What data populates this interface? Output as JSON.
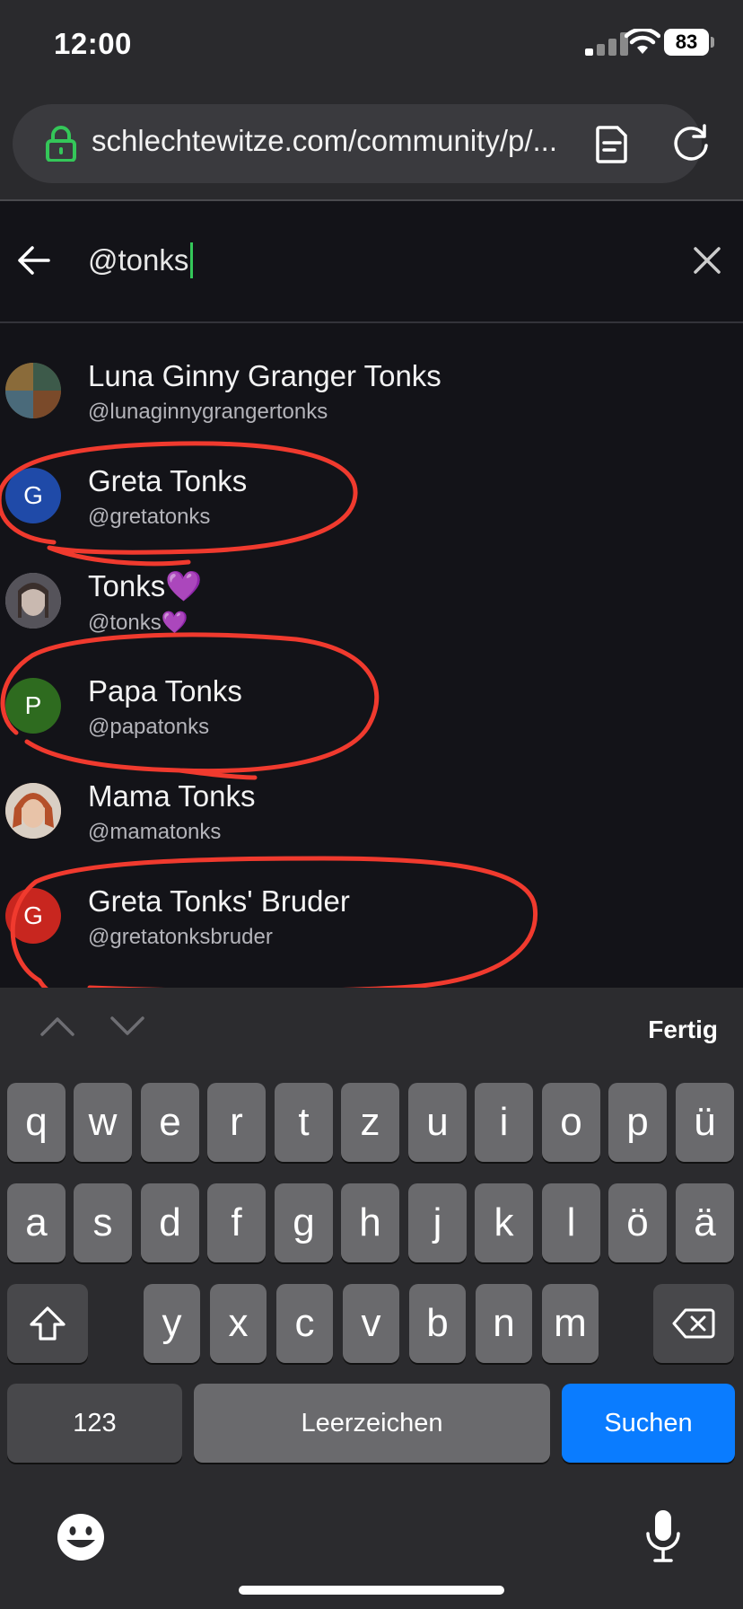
{
  "status_bar": {
    "time": "12:00",
    "battery": "83"
  },
  "browser": {
    "url": "schlechtewitze.com/community/p/..."
  },
  "search": {
    "query": "@tonks"
  },
  "results": [
    {
      "name": "Luna Ginny Granger Tonks",
      "handle": "@lunaginnygrangertonks",
      "avatar_kind": "image",
      "avatar_letter": "",
      "avatar_color": "#6b5a3a"
    },
    {
      "name": "Greta Tonks",
      "handle": "@gretatonks",
      "avatar_kind": "letter",
      "avatar_letter": "G",
      "avatar_color": "#1f4aa8"
    },
    {
      "name": "Tonks💜",
      "handle": "@tonks💜",
      "avatar_kind": "image",
      "avatar_letter": "",
      "avatar_color": "#8a8890"
    },
    {
      "name": "Papa Tonks",
      "handle": "@papatonks",
      "avatar_kind": "letter",
      "avatar_letter": "P",
      "avatar_color": "#2e6b1f"
    },
    {
      "name": "Mama Tonks",
      "handle": "@mamatonks",
      "avatar_kind": "image",
      "avatar_letter": "",
      "avatar_color": "#c07a4a"
    },
    {
      "name": "Greta Tonks' Bruder",
      "handle": "@gretatonksbruder",
      "avatar_kind": "letter",
      "avatar_letter": "G",
      "avatar_color": "#c8261f"
    }
  ],
  "keyboard": {
    "done_label": "Fertig",
    "row1": [
      "q",
      "w",
      "e",
      "r",
      "t",
      "z",
      "u",
      "i",
      "o",
      "p",
      "ü"
    ],
    "row2": [
      "a",
      "s",
      "d",
      "f",
      "g",
      "h",
      "j",
      "k",
      "l",
      "ö",
      "ä"
    ],
    "row3": [
      "y",
      "x",
      "c",
      "v",
      "b",
      "n",
      "m"
    ],
    "numbers_label": "123",
    "space_label": "Leerzeichen",
    "search_label": "Suchen"
  },
  "colors": {
    "accent_blue": "#0a7cff",
    "annotation_red": "#f03a2e",
    "caret_green": "#34c759",
    "lock_green": "#34c759"
  },
  "icons": [
    "lock-icon",
    "reader-mode-icon",
    "reload-icon",
    "back-arrow-icon",
    "clear-icon",
    "chevron-up-icon",
    "chevron-down-icon",
    "shift-icon",
    "backspace-icon",
    "emoji-icon",
    "microphone-icon"
  ]
}
